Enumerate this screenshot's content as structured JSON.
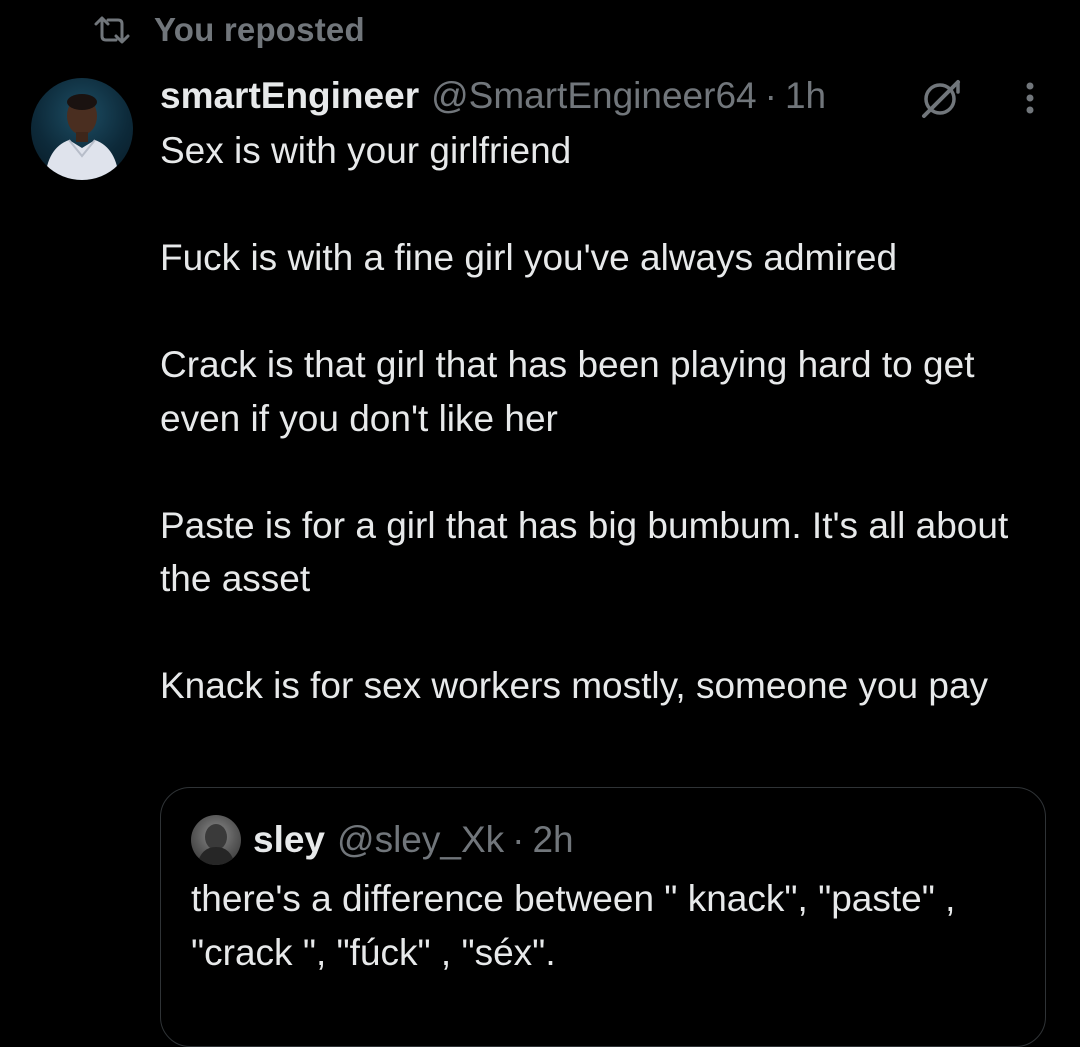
{
  "repost_banner": {
    "icon": "repost-icon",
    "text": "You reposted"
  },
  "tweet": {
    "display_name": "smartEngineer",
    "handle": "@SmartEngineer64",
    "separator": "·",
    "time": "1h",
    "paragraphs": [
      "Sex is with your girlfriend",
      "Fuck is with a fine girl you've always admired",
      "Crack is that girl that has been playing hard to get even if you don't like her",
      "Paste is for a girl that has big bumbum. It's all about the asset",
      "Knack is for sex workers mostly, someone you pay"
    ],
    "icons": {
      "grok": "grok-icon",
      "more": "more-options-icon"
    }
  },
  "quote": {
    "display_name": "sley",
    "handle": "@sley_Xk",
    "separator": "·",
    "time": "2h",
    "text": "there's a difference between \" knack\", \"paste\" , \"crack \", \"fúck\" , \"séx\"."
  },
  "colors": {
    "background": "#000000",
    "primary_text": "#e7e9ea",
    "secondary_text": "#71767b",
    "border": "#2f3336"
  }
}
